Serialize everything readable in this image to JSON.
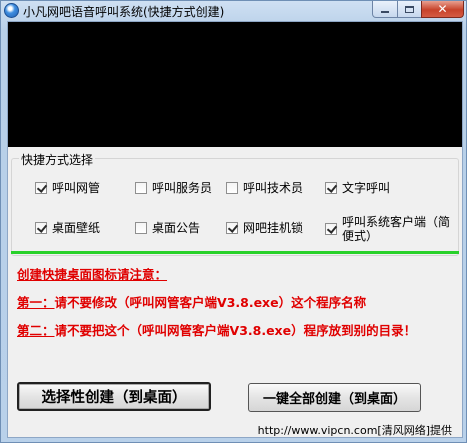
{
  "window": {
    "title": "小凡网吧语音呼叫系统(快捷方式创建)",
    "close_glyph": "✕"
  },
  "group": {
    "legend": "快捷方式选择",
    "options": [
      {
        "label": "呼叫网管",
        "checked": true
      },
      {
        "label": "呼叫服务员",
        "checked": false
      },
      {
        "label": "呼叫技术员",
        "checked": false
      },
      {
        "label": "文字呼叫",
        "checked": true
      },
      {
        "label": "桌面壁纸",
        "checked": true
      },
      {
        "label": "桌面公告",
        "checked": false
      },
      {
        "label": "网吧挂机锁",
        "checked": true
      },
      {
        "label": "呼叫系统客户端（简便式）",
        "checked": true
      }
    ]
  },
  "notice": {
    "title": "创建快捷桌面图标请注意：",
    "line1_prefix": "第一：",
    "line1_text": "请不要修改（呼叫网管客户端V3.8.exe）这个程序名称",
    "line2_prefix": "第二：",
    "line2_text": "请不要把这个（呼叫网管客户端V3.8.exe）程序放到别的目录！"
  },
  "buttons": {
    "select_create": "选择性创建（到桌面）",
    "create_all": "一键全部创建（到桌面）"
  },
  "status": {
    "text": "http://www.vipcn.com[清风网络]提供"
  },
  "colors": {
    "notice_red": "#e00000",
    "separator_green": "#28d12a",
    "display_black": "#000000"
  }
}
